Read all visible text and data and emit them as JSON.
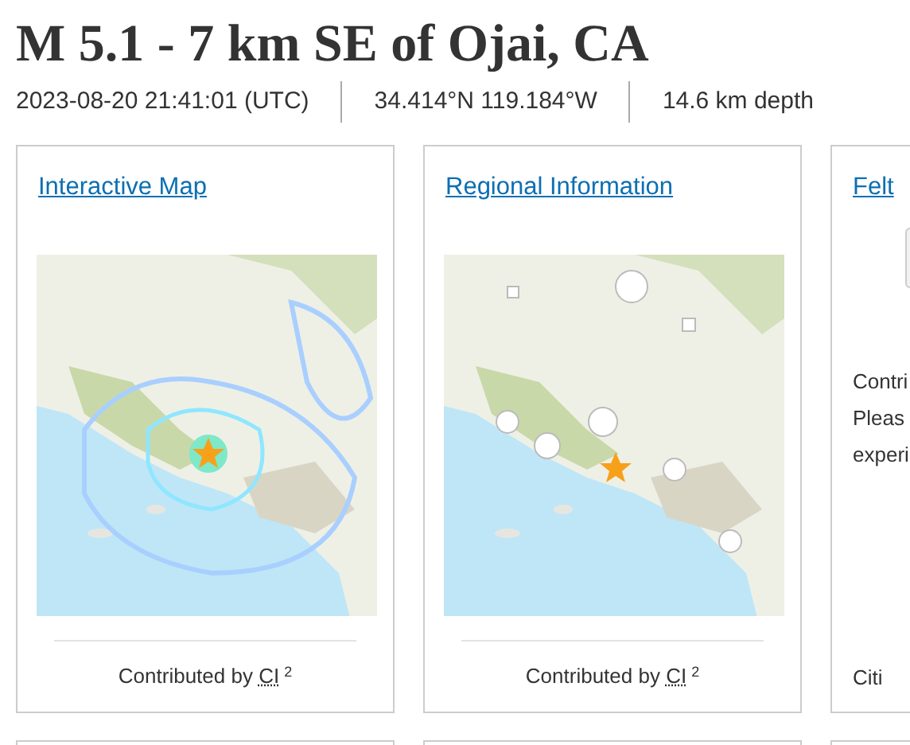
{
  "title": "M 5.1 - 7 km SE of Ojai, CA",
  "meta": [
    "2023-08-20 21:41:01 (UTC)",
    "34.414°N 119.184°W",
    "14.6 km depth"
  ],
  "cards": [
    {
      "kind": "map",
      "link": "Interactive Map",
      "footer": {
        "prefix": "Contributed by",
        "source": "CI",
        "note": "2"
      }
    },
    {
      "kind": "map",
      "link": "Regional Information",
      "footer": {
        "prefix": "Contributed by",
        "source": "CI",
        "note": "2"
      }
    },
    {
      "kind": "text",
      "link": "Felt",
      "lines": [
        "Contri",
        "Pleas",
        "experi"
      ],
      "footer_text": "Citi"
    }
  ]
}
